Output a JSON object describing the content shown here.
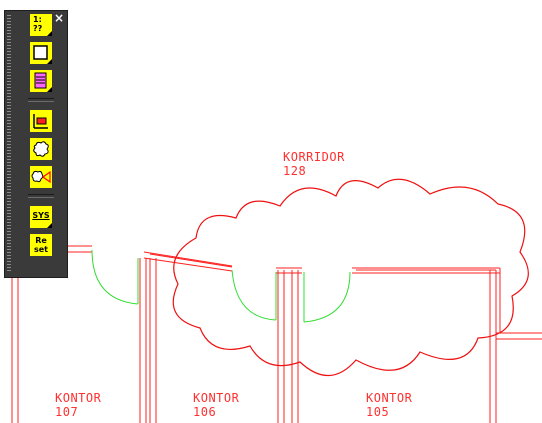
{
  "labels": {
    "korridor_name": "KORRIDOR",
    "korridor_number": "128",
    "kontor_a_name": "KONTOR",
    "kontor_a_number": "107",
    "kontor_b_name": "KONTOR",
    "kontor_b_number": "106",
    "kontor_c_name": "KONTOR",
    "kontor_c_number": "105"
  },
  "toolbar": {
    "scale_button_text": "1:\n??",
    "sys_button_text": "SYS",
    "reset_button_text": "Re\nset",
    "close_glyph": "×"
  },
  "colors": {
    "wall": "#ff0000",
    "door_swing": "#33dd33",
    "revision_cloud": "#ee1111",
    "toolbar_bg": "#3a3a3a",
    "button_bg": "#ffff00"
  }
}
